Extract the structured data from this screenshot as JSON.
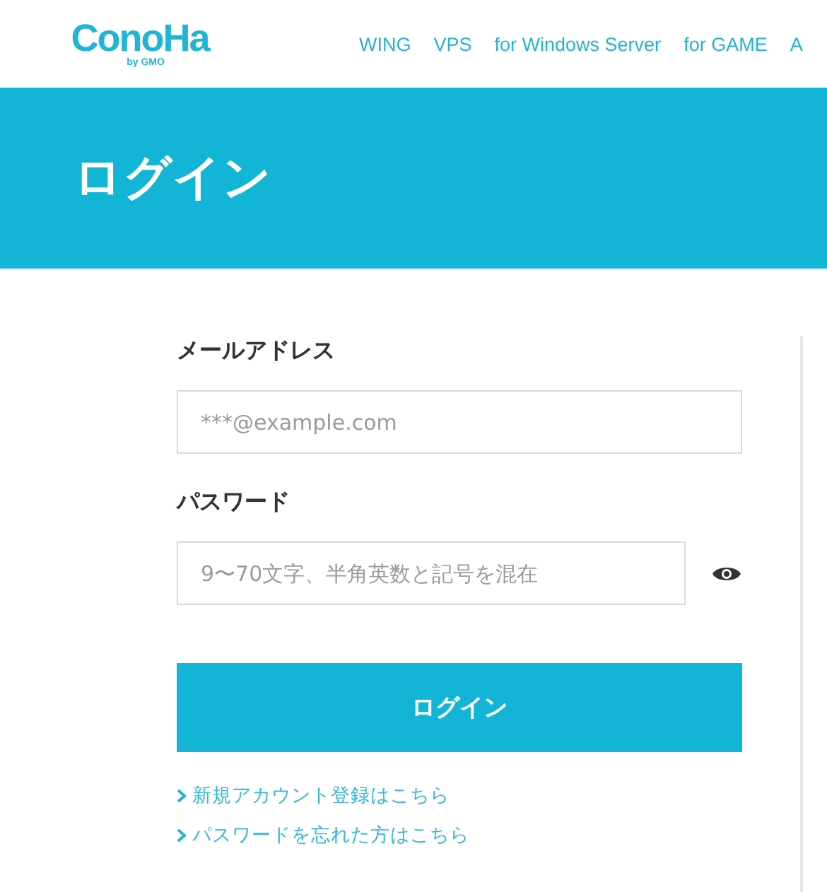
{
  "header": {
    "logo": {
      "name": "ConoHa",
      "byline": "by GMO"
    },
    "nav": [
      "WING",
      "VPS",
      "for Windows Server",
      "for GAME",
      "A"
    ]
  },
  "banner": {
    "title": "ログイン"
  },
  "form": {
    "fields": [
      {
        "label": "メールアドレス",
        "placeholder": "***@example.com",
        "kind": "email"
      },
      {
        "label": "パスワード",
        "placeholder": "9〜70文字、半角英数と記号を混在",
        "kind": "password"
      }
    ],
    "submit": "ログイン",
    "links": [
      "新規アカウント登録はこちら",
      "パスワードを忘れた方はこちら"
    ]
  }
}
